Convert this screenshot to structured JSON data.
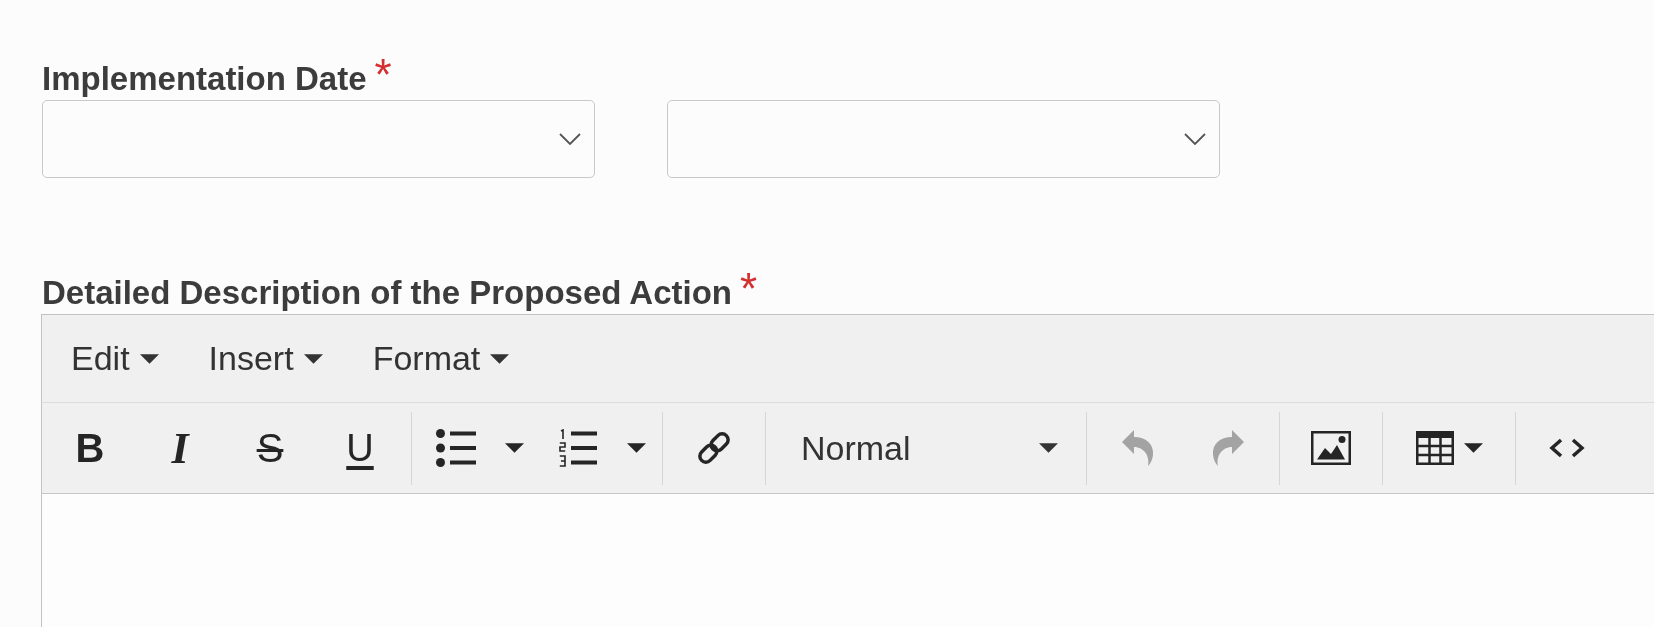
{
  "date_field": {
    "label": "Implementation Date",
    "required_mark": "*",
    "selects": [
      {
        "kind": "dropdown"
      },
      {
        "kind": "dropdown"
      }
    ]
  },
  "description_field": {
    "label": "Detailed Description of the Proposed Action",
    "required_mark": "*",
    "editor": {
      "menubar": [
        {
          "label": "Edit",
          "dropdown": true
        },
        {
          "label": "Insert",
          "dropdown": true
        },
        {
          "label": "Format",
          "dropdown": true
        }
      ],
      "toolbar": [
        {
          "items": [
            {
              "kind": "bold",
              "glyph": "B",
              "disabled": false,
              "dropdown": false
            },
            {
              "kind": "italic",
              "glyph": "I",
              "disabled": false,
              "dropdown": false
            },
            {
              "kind": "strikethrough",
              "glyph": "S",
              "disabled": false,
              "dropdown": false
            },
            {
              "kind": "underline",
              "glyph": "U",
              "disabled": false,
              "dropdown": false
            }
          ]
        },
        {
          "items": [
            {
              "kind": "bullet-list",
              "disabled": false,
              "dropdown": true
            },
            {
              "kind": "numbered-list",
              "disabled": false,
              "dropdown": true
            }
          ]
        },
        {
          "items": [
            {
              "kind": "link",
              "disabled": false,
              "dropdown": false
            }
          ]
        },
        {
          "items": [
            {
              "kind": "format-select",
              "value": "Normal",
              "disabled": false,
              "dropdown": true
            }
          ]
        },
        {
          "items": [
            {
              "kind": "undo",
              "disabled": true,
              "dropdown": false
            },
            {
              "kind": "redo",
              "disabled": true,
              "dropdown": false
            }
          ]
        },
        {
          "items": [
            {
              "kind": "image",
              "disabled": false,
              "dropdown": false
            }
          ]
        },
        {
          "items": [
            {
              "kind": "table",
              "disabled": false,
              "dropdown": true
            }
          ]
        },
        {
          "items": [
            {
              "kind": "code",
              "disabled": false,
              "dropdown": false
            }
          ]
        }
      ]
    }
  }
}
